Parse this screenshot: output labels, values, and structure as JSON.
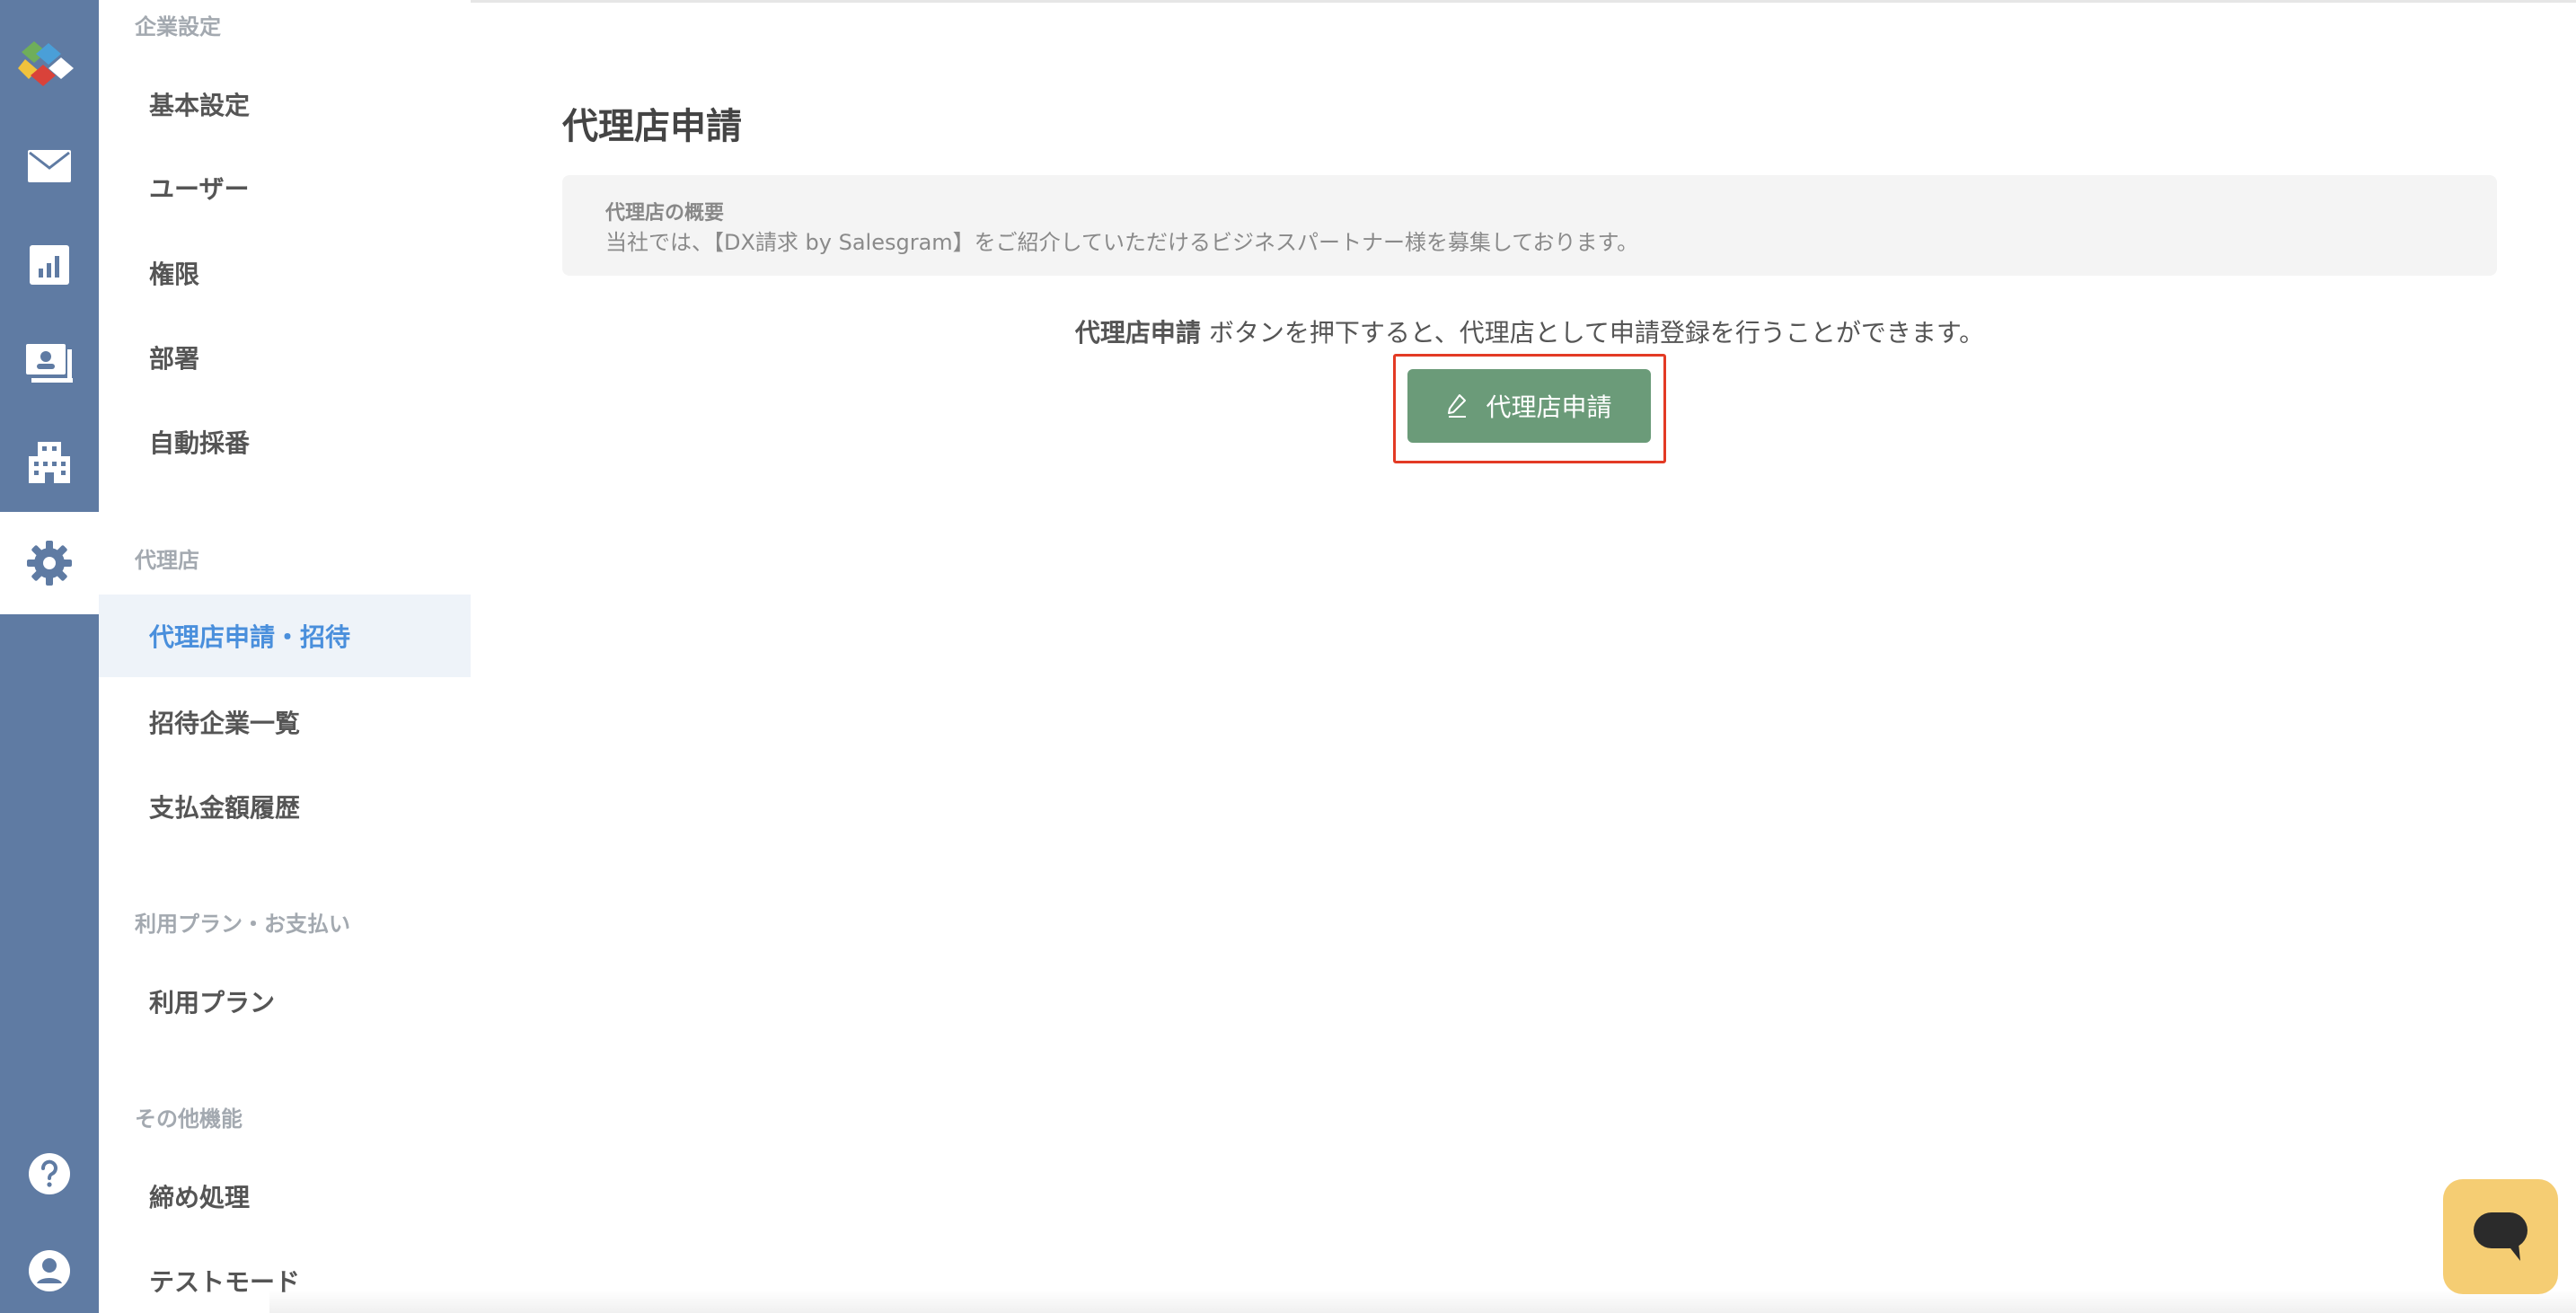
{
  "icons": {
    "logo": "salesgram-logo-icon",
    "mail": "mail-icon",
    "chart": "bar-chart-icon",
    "invoice": "invoice-icon",
    "company": "building-icon",
    "settings": "gear-icon",
    "help": "help-icon",
    "account": "user-circle-icon",
    "chat": "chat-icon"
  },
  "colors": {
    "rail": "#5f7ba3",
    "active_text": "#4a8fdc",
    "active_bg": "#eef3f9",
    "button": "#6b9b79",
    "highlight": "#e33a24",
    "chat": "#f5cd73"
  },
  "sidebar": {
    "sections": [
      {
        "title": "企業設定",
        "items": [
          "基本設定",
          "ユーザー",
          "権限",
          "部署",
          "自動採番"
        ]
      },
      {
        "title": "代理店",
        "items": [
          "代理店申請・招待",
          "招待企業一覧",
          "支払金額履歴"
        ]
      },
      {
        "title": "利用プラン・お支払い",
        "items": [
          "利用プラン"
        ]
      },
      {
        "title": "その他機能",
        "items": [
          "締め処理",
          "テストモード"
        ]
      }
    ],
    "active_item": "代理店申請・招待"
  },
  "main": {
    "title": "代理店申請",
    "overview": {
      "title": "代理店の概要",
      "description": "当社では、【DX請求 by Salesgram】をご紹介していただけるビジネスパートナー様を募集しております。"
    },
    "instruction": {
      "strong": "代理店申請",
      "rest": " ボタンを押下すると、代理店として申請登録を行うことができます。"
    },
    "apply_button_label": "代理店申請"
  }
}
